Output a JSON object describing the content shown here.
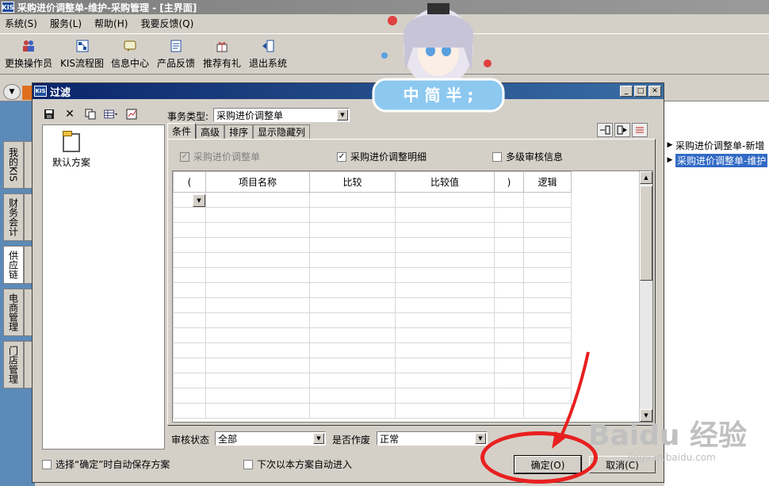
{
  "main_window": {
    "title": "采购进价调整单-维护-采购管理 - [主界面]",
    "logo": "KIS"
  },
  "menu": [
    {
      "label": "系统(S)"
    },
    {
      "label": "服务(L)"
    },
    {
      "label": "帮助(H)"
    },
    {
      "label": "我要反馈(Q)"
    }
  ],
  "toolbar": [
    {
      "label": "更换操作员",
      "icon": "change-user-icon"
    },
    {
      "label": "KIS流程图",
      "icon": "flowchart-icon"
    },
    {
      "label": "信息中心",
      "icon": "info-center-icon"
    },
    {
      "label": "产品反馈",
      "icon": "feedback-icon"
    },
    {
      "label": "推荐有礼",
      "icon": "gift-icon"
    },
    {
      "label": "退出系统",
      "icon": "exit-icon"
    }
  ],
  "left_tabs": [
    {
      "label": "我的KIS"
    },
    {
      "label": "财务会计"
    },
    {
      "label": "供应链"
    },
    {
      "label": "电商管理"
    },
    {
      "label": "门店管理"
    }
  ],
  "right_list": [
    {
      "label": "采购进价调整单-新增"
    },
    {
      "label": "采购进价调整单-维护"
    }
  ],
  "dialog": {
    "title": "过滤",
    "logo": "KIS",
    "scheme_default": "默认方案",
    "business_type_label": "事务类型:",
    "business_type_value": "采购进价调整单",
    "tabs": [
      {
        "label": "条件"
      },
      {
        "label": "高级"
      },
      {
        "label": "排序"
      },
      {
        "label": "显示隐藏列"
      }
    ],
    "checkboxes": {
      "header": {
        "label": "采购进价调整单",
        "checked": true,
        "disabled": true
      },
      "detail": {
        "label": "采购进价调整明细",
        "checked": true
      },
      "multi_audit": {
        "label": "多级审核信息",
        "checked": false
      }
    },
    "grid_columns": [
      "(",
      "项目名称",
      "比较",
      "比较值",
      ")",
      "逻辑"
    ],
    "audit_status_label": "审核状态",
    "audit_status_value": "全部",
    "void_label": "是否作废",
    "void_value": "正常",
    "auto_save_label": "选择“确定”时自动保存方案",
    "auto_enter_label": "下次以本方案自动进入",
    "ok_label": "确定(O)",
    "cancel_label": "取消(C)"
  },
  "overlay": {
    "banner_text": "中 简 半 ;",
    "watermark": "Baidu 经验",
    "watermark_sub": "jingyan.baidu.com"
  },
  "colors": {
    "dialog_title": "#0a246a",
    "highlight": "#316ac5",
    "annotation": "#e82020"
  }
}
